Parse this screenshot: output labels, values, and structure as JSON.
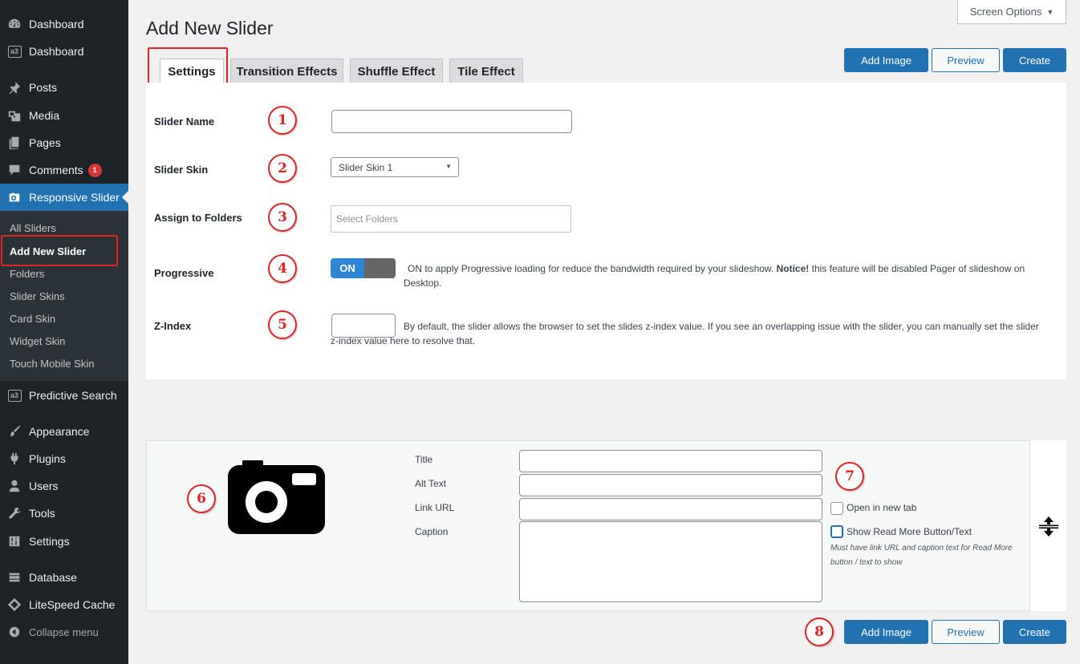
{
  "sidebar": {
    "items": [
      {
        "label": "Dashboard",
        "icon": "dashboard-icon"
      },
      {
        "label": "Dashboard",
        "icon": "a3-icon",
        "icon_text": "a3"
      },
      {
        "label": "Posts",
        "icon": "pin-icon"
      },
      {
        "label": "Media",
        "icon": "media-icon"
      },
      {
        "label": "Pages",
        "icon": "pages-icon"
      },
      {
        "label": "Comments",
        "icon": "comment-icon",
        "badge": "1"
      },
      {
        "label": "Responsive Slider",
        "icon": "camera-icon"
      },
      {
        "label": "Predictive Search",
        "icon": "a3-icon",
        "icon_text": "a3"
      },
      {
        "label": "Appearance",
        "icon": "brush-icon"
      },
      {
        "label": "Plugins",
        "icon": "plugin-icon"
      },
      {
        "label": "Users",
        "icon": "user-icon"
      },
      {
        "label": "Tools",
        "icon": "wrench-icon"
      },
      {
        "label": "Settings",
        "icon": "sliders-icon"
      },
      {
        "label": "Database",
        "icon": "database-icon"
      },
      {
        "label": "LiteSpeed Cache",
        "icon": "diamond-icon"
      },
      {
        "label": "Collapse menu",
        "icon": "collapse-icon"
      }
    ],
    "submenu": [
      "All Sliders",
      "Add New Slider",
      "Folders",
      "Slider Skins",
      "Card Skin",
      "Widget Skin",
      "Touch Mobile Skin"
    ]
  },
  "header": {
    "title": "Add New Slider",
    "screen_options": "Screen Options"
  },
  "tabs": [
    "Settings",
    "Transition Effects",
    "Shuffle Effect",
    "Tile Effect"
  ],
  "actions": {
    "add_image": "Add Image",
    "preview": "Preview",
    "create": "Create"
  },
  "settings": {
    "slider_name": {
      "label": "Slider Name",
      "value": ""
    },
    "slider_skin": {
      "label": "Slider Skin",
      "value": "Slider Skin 1"
    },
    "folders": {
      "label": "Assign to Folders",
      "placeholder": "Select Folders"
    },
    "progressive": {
      "label": "Progressive",
      "toggle": "ON",
      "help_pre": "ON to apply Progressive loading for reduce the bandwidth required by your slideshow.",
      "help_bold": "Notice!",
      "help_post": "this feature will be disabled Pager of slideshow on Desktop."
    },
    "zindex": {
      "label": "Z-Index",
      "value": "",
      "help": "By default, the slider allows the browser to set the slides z-index value. If you see an overlapping issue with the slider, you can manually set the slider z-index value here to resolve that."
    }
  },
  "image_panel": {
    "title_label": "Title",
    "alt_label": "Alt Text",
    "link_label": "Link URL",
    "caption_label": "Caption",
    "open_new_tab": "Open in new tab",
    "show_read_more": "Show Read More Button/Text",
    "note": "Must have link URL and caption text for Read More button / text to show"
  },
  "annotations": [
    "1",
    "2",
    "3",
    "4",
    "5",
    "6",
    "7",
    "8"
  ],
  "colors": {
    "sidebar_bg": "#1d2327",
    "submenu_bg": "#2c3338",
    "accent": "#2271b1",
    "annotation_red": "#e02424",
    "toggle_on": "#2f86d4"
  }
}
